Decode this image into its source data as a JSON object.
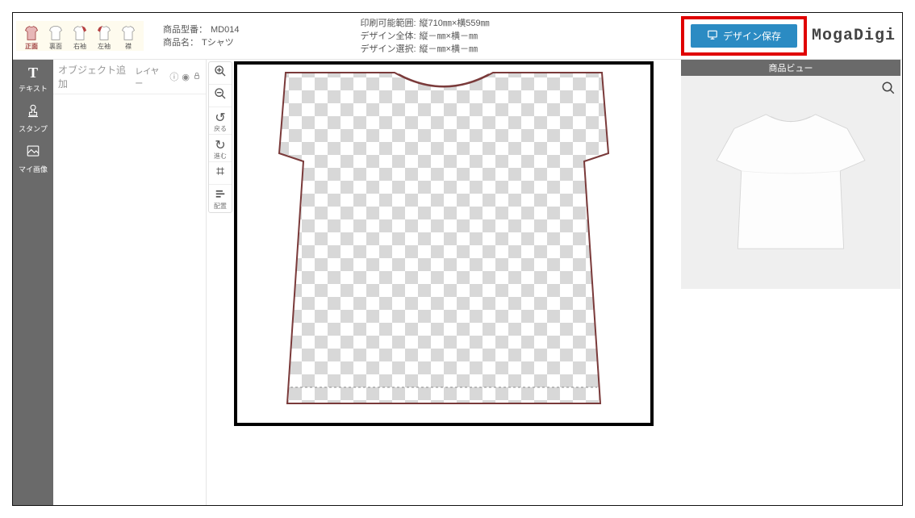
{
  "logo": "MogaDigi",
  "topbar": {
    "views": [
      {
        "label": "正面",
        "active": true
      },
      {
        "label": "裏面",
        "active": false
      },
      {
        "label": "右袖",
        "active": false
      },
      {
        "label": "左袖",
        "active": false
      },
      {
        "label": "襟",
        "active": false
      }
    ],
    "meta_left": {
      "model_label": "商品型番：",
      "model_value": "MD014",
      "name_label": "商品名：",
      "name_value": "Tシャツ"
    },
    "meta_right": {
      "print_label": "印刷可能範囲:",
      "print_value": "縦710㎜×横559㎜",
      "whole_label": "デザイン全体:",
      "whole_value": "縦－㎜×横－㎜",
      "sel_label": "デザイン選択:",
      "sel_value": "縦－㎜×横－㎜"
    },
    "save_button": "デザイン保存"
  },
  "sidebar": {
    "items": [
      {
        "glyph": "T",
        "label": "テキスト"
      },
      {
        "glyph": "stamp",
        "label": "スタンプ"
      },
      {
        "glyph": "image",
        "label": "マイ画像"
      }
    ]
  },
  "leftpanel": {
    "title": "オブジェクト追加",
    "layer_label": "レイヤー"
  },
  "canvas_tools": {
    "zoom_in": "＋",
    "zoom_out": "－",
    "undo_label": "戻る",
    "redo_label": "進む",
    "grid": "＃",
    "align": "配置"
  },
  "rightpanel": {
    "title": "商品ビュー"
  }
}
